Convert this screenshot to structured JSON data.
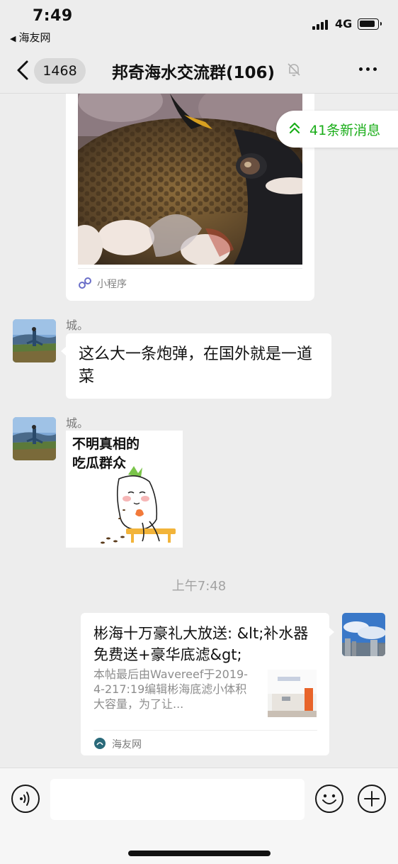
{
  "status_bar": {
    "time": "7:49",
    "back_app": "海友网",
    "network": "4G"
  },
  "nav": {
    "unread_count": "1468",
    "title": "邦奇海水交流群(106)",
    "icons": [
      "back-chevron-icon",
      "mute-bell-icon",
      "more-dots-icon"
    ]
  },
  "new_messages": {
    "label": "41条新消息"
  },
  "messages": {
    "mini_program": {
      "label": "小程序",
      "image": "pufferfish-photo"
    },
    "msg1": {
      "sender": "城。",
      "text": "这么大一条炮弹，在国外就是一道菜"
    },
    "msg2": {
      "sender": "城。",
      "sticker_caption_line1": "不明真相的",
      "sticker_caption_line2": "吃瓜群众"
    },
    "timestamp": "上午7:48",
    "link_card": {
      "title": "彬海十万豪礼大放送: &lt;补水器免费送+豪华底滤&gt;",
      "description": "本帖最后由Wavereef于2019-4-217:19编辑彬海底滤小体积大容量，为了让...",
      "source": "海友网"
    }
  },
  "input_bar": {
    "placeholder": "",
    "icons": [
      "voice-icon",
      "emoji-icon",
      "plus-icon"
    ]
  },
  "colors": {
    "background": "#ededed",
    "accent_green": "#1aad19",
    "bubble": "#ffffff"
  }
}
